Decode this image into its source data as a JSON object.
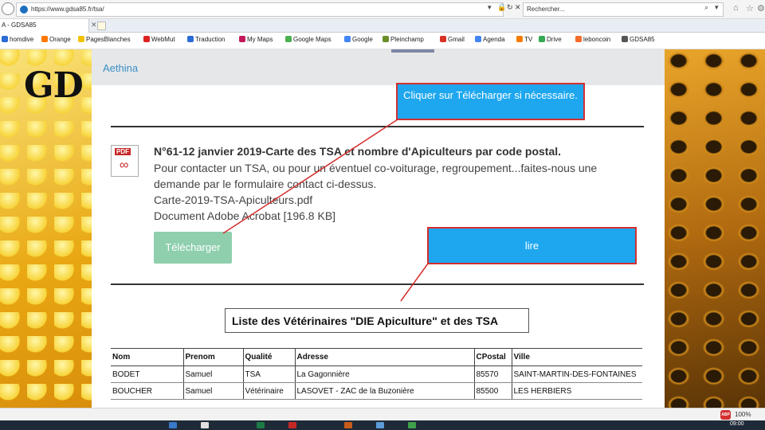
{
  "browser": {
    "url": "https://www.gdsa85.fr/tsa/",
    "search_placeholder": "Rechercher...",
    "tab_label": "A - GDSA85",
    "favorites": [
      {
        "label": "homdive",
        "color": "#2b6cd4"
      },
      {
        "label": "Orange",
        "color": "#ff7900"
      },
      {
        "label": "PagesBlanches",
        "color": "#f2c300"
      },
      {
        "label": "WebMut",
        "color": "#d22"
      },
      {
        "label": "Traduction",
        "color": "#2b6cd4"
      },
      {
        "label": "My Maps",
        "color": "#c2185b"
      },
      {
        "label": "Google Maps",
        "color": "#4caf50"
      },
      {
        "label": "Google",
        "color": "#4285f4"
      },
      {
        "label": "Pleinchamp",
        "color": "#6a8f2a"
      },
      {
        "label": "Gmail",
        "color": "#d93025"
      },
      {
        "label": "Agenda",
        "color": "#4285f4"
      },
      {
        "label": "TV",
        "color": "#f57c00"
      },
      {
        "label": "Drive",
        "color": "#34a853"
      },
      {
        "label": "leboncoin",
        "color": "#f56b2a"
      },
      {
        "label": "GDSA85",
        "color": "#555"
      }
    ]
  },
  "site": {
    "logo": "GD",
    "title": "Aethina"
  },
  "document": {
    "title": "N°61-12 janvier 2019-Carte des TSA et nombre d'Apiculteurs par code postal.",
    "description_lines": [
      "Pour contacter un TSA, ou pour un éventuel co-voiturage, regroupement...faites-nous une",
      "demande par le formulaire contact ci-dessus."
    ],
    "filename": "Carte-2019-TSA-Apiculteurs.pdf",
    "filetype": "Document Adobe Acrobat [196.8 KB]",
    "pdf_badge": "PDF",
    "download_label": "Télécharger"
  },
  "callouts": {
    "first": "Cliquer sur Télécharger si nécessaire.",
    "second": "lire"
  },
  "list": {
    "title": "Liste des Vétérinaires \"DIE Apiculture\" et des TSA",
    "columns": [
      "Nom",
      "Prenom",
      "Qualité",
      "Adresse",
      "CPostal",
      "Ville"
    ],
    "rows": [
      [
        "BODET",
        "Samuel",
        "TSA",
        "La Gagonnière",
        "85570",
        "SAINT-MARTIN-DES-FONTAINES"
      ],
      [
        "BOUCHER",
        "Samuel",
        "Vétérinaire",
        "LASOVET - ZAC de la Buzonière",
        "85500",
        "LES HERBIERS"
      ]
    ]
  },
  "status": {
    "abp": "ABP",
    "zoom": "100%",
    "clock": "09:00"
  }
}
